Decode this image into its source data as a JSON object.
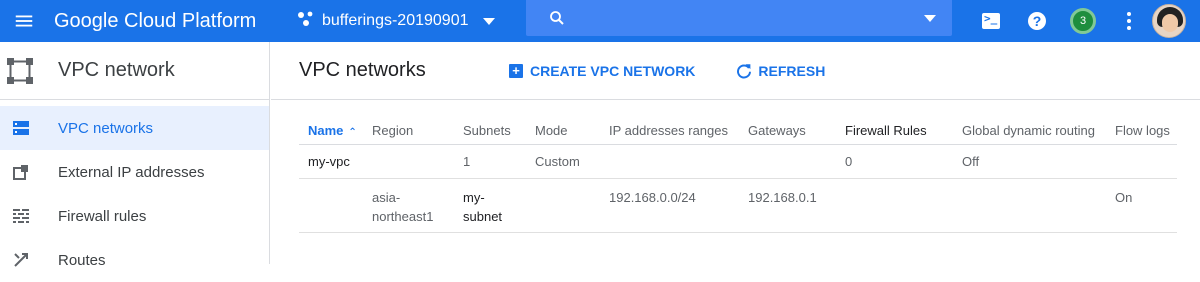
{
  "header": {
    "brand": "Google Cloud Platform",
    "project_name": "bufferings-20190901",
    "search_placeholder": "",
    "notification_count": "3",
    "icons": [
      "menu-icon",
      "project-dots-icon",
      "search-icon",
      "cloud-shell-icon",
      "help-icon",
      "notifications-icon",
      "more-vert-icon",
      "avatar"
    ]
  },
  "sidebar": {
    "title": "VPC network",
    "items": [
      {
        "label": "VPC networks",
        "icon": "vpc-networks-icon",
        "active": true
      },
      {
        "label": "External IP addresses",
        "icon": "external-ip-icon",
        "active": false
      },
      {
        "label": "Firewall rules",
        "icon": "firewall-icon",
        "active": false
      },
      {
        "label": "Routes",
        "icon": "routes-icon",
        "active": false
      }
    ]
  },
  "main": {
    "title": "VPC networks",
    "create_label": "CREATE VPC NETWORK",
    "refresh_label": "REFRESH",
    "table": {
      "columns": [
        "Name",
        "Region",
        "Subnets",
        "Mode",
        "IP addresses ranges",
        "Gateways",
        "Firewall Rules",
        "Global dynamic routing",
        "Flow logs"
      ],
      "rows": [
        {
          "name": "my-vpc",
          "region": "",
          "subnets": "1",
          "mode": "Custom",
          "ip_ranges": "",
          "gateways": "",
          "firewall_rules": "0",
          "global_routing": "Off",
          "flow_logs": ""
        },
        {
          "name": "",
          "region": "asia-northeast1",
          "region_line1": "asia-",
          "region_line2": "northeast1",
          "subnets": "my-subnet",
          "subnets_line1": "my-",
          "subnets_line2": "subnet",
          "mode": "",
          "ip_ranges": "192.168.0.0/24",
          "gateways": "192.168.0.1",
          "firewall_rules": "",
          "global_routing": "",
          "flow_logs": "On"
        }
      ]
    }
  },
  "colors": {
    "accent": "#1a73e8",
    "topbar": "#1a73e8",
    "search": "#4285f4",
    "active_bg": "#e8f0fe"
  }
}
